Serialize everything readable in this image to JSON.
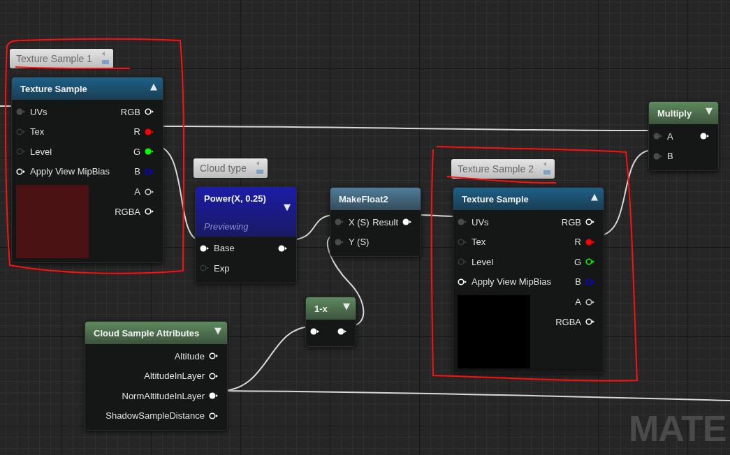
{
  "nodes": [
    {
      "comment": "Texture Sample 1",
      "title": "Texture Sample",
      "toggle": "▲",
      "color": "#1d6088",
      "inputs": [
        {
          "label": "UVs",
          "color": "#4a4a4a",
          "connected": true
        },
        {
          "label": "Tex",
          "color": "#3a3a3a",
          "connected": false
        },
        {
          "label": "Level",
          "color": "#3a3a3a",
          "connected": false
        },
        {
          "label": "Apply View MipBias",
          "color": "#ffffff",
          "connected": false
        }
      ],
      "outputs": [
        {
          "label": "RGB",
          "color": "#ffffff",
          "connected": false
        },
        {
          "label": "R",
          "color": "#ff0000",
          "connected": true
        },
        {
          "label": "G",
          "color": "#00ff00",
          "connected": true
        },
        {
          "label": "B",
          "color": "#0000ff",
          "connected": false
        },
        {
          "label": "A",
          "color": "#c8c8c8",
          "connected": false
        },
        {
          "label": "RGBA",
          "color": "#ffffff",
          "connected": false
        }
      ],
      "preview": {
        "color": "#4a1212"
      }
    },
    {
      "comment": "Cloud type",
      "title": "Power(X, 0.25)",
      "subtitle": "Previewing",
      "toggle": "▼",
      "color": "#1c1ca8",
      "inputs": [
        {
          "label": "Base",
          "color": "#ffffff",
          "connected": true
        },
        {
          "label": "Exp",
          "color": "#3a3a3a",
          "connected": false
        }
      ],
      "outputs": [
        {
          "color": "#ffffff",
          "connected": true
        }
      ]
    },
    {
      "title": "MakeFloat2",
      "color": "#4f7d99",
      "inputs": [
        {
          "label": "X (S)",
          "color": "#4a4a4a",
          "connected": true
        },
        {
          "label": "Y (S)",
          "color": "#4a4a4a",
          "connected": true
        }
      ],
      "outputs": [
        {
          "label": "Result",
          "color": "#ffffff",
          "connected": true
        }
      ]
    },
    {
      "comment": "Texture Sample 2",
      "title": "Texture Sample",
      "toggle": "▲",
      "color": "#1d6088",
      "inputs": [
        {
          "label": "UVs",
          "color": "#4a4a4a",
          "connected": true
        },
        {
          "label": "Tex",
          "color": "#3a3a3a",
          "connected": false
        },
        {
          "label": "Level",
          "color": "#3a3a3a",
          "connected": false
        },
        {
          "label": "Apply View MipBias",
          "color": "#ffffff",
          "connected": false
        }
      ],
      "outputs": [
        {
          "label": "RGB",
          "color": "#ffffff",
          "connected": false
        },
        {
          "label": "R",
          "color": "#ff0000",
          "connected": true
        },
        {
          "label": "G",
          "color": "#00ff00",
          "connected": false
        },
        {
          "label": "B",
          "color": "#0000ff",
          "connected": false
        },
        {
          "label": "A",
          "color": "#c8c8c8",
          "connected": false
        },
        {
          "label": "RGBA",
          "color": "#ffffff",
          "connected": false
        }
      ],
      "preview": {
        "color": "#000000"
      }
    },
    {
      "title": "Multiply",
      "toggle": "▼",
      "color": "#5e8a5e",
      "inputs": [
        {
          "label": "A",
          "color": "#4a4a4a",
          "connected": true
        },
        {
          "label": "B",
          "color": "#4a4a4a",
          "connected": true
        }
      ],
      "outputs": [
        {
          "color": "#ffffff",
          "connected": true
        }
      ]
    },
    {
      "title": "1-x",
      "toggle": "▼",
      "color": "#5e8a5e",
      "inputs": [
        {
          "color": "#ffffff",
          "connected": true
        }
      ],
      "outputs": [
        {
          "color": "#ffffff",
          "connected": true
        }
      ]
    },
    {
      "title": "Cloud Sample Attributes",
      "toggle": "▼",
      "color": "#5e8a5e",
      "outputs": [
        {
          "label": "Altitude",
          "color": "#ffffff",
          "connected": false
        },
        {
          "label": "AltitudeInLayer",
          "color": "#ffffff",
          "connected": false
        },
        {
          "label": "NormAltitudeInLayer",
          "color": "#ffffff",
          "connected": true
        },
        {
          "label": "ShadowSampleDistance",
          "color": "#ffffff",
          "connected": false
        }
      ]
    }
  ],
  "background_label": "MATE"
}
